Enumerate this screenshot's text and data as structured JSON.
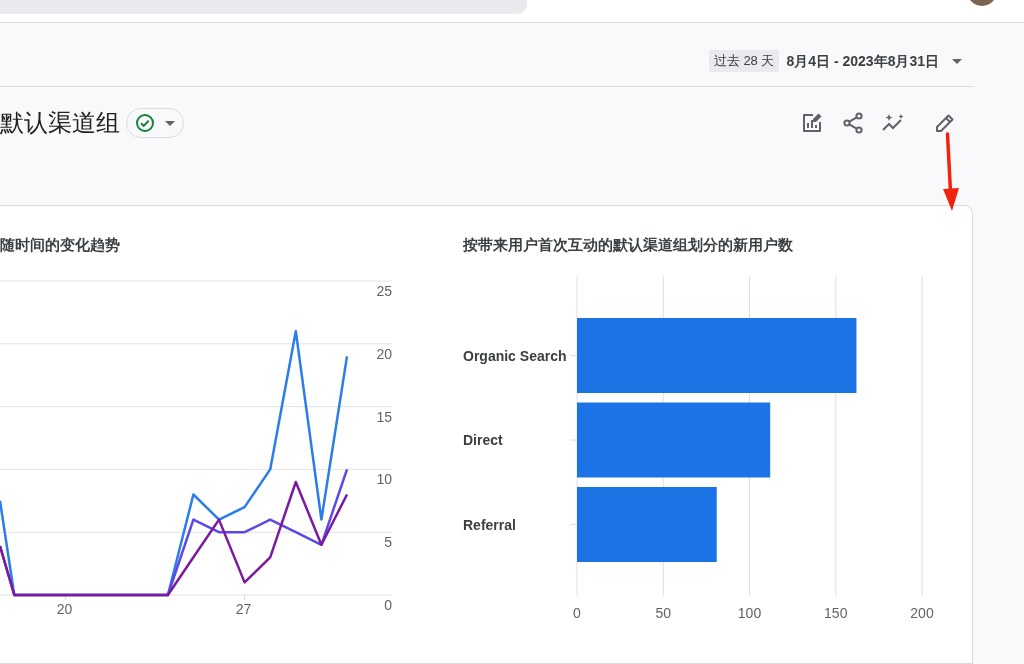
{
  "header": {
    "date_preset": "过去 28 天",
    "date_range": "8月4日 - 2023年8月31日"
  },
  "report": {
    "title": "默认渠道组"
  },
  "cards": [
    {
      "title": "随时间的变化趋势",
      "chart_data": {
        "type": "line",
        "x": [
          17.44,
          18,
          19,
          20,
          21,
          22,
          23,
          24,
          25,
          26,
          27,
          28,
          29,
          30,
          31
        ],
        "xlim": [
          17.44,
          32.76
        ],
        "xticks": [
          20,
          27
        ],
        "grid": true,
        "ylim": [
          0,
          25
        ],
        "yticks": [
          0,
          5,
          10,
          15,
          20,
          25
        ],
        "series": [
          {
            "color": "#2b7de9",
            "values": [
              7.5,
              0,
              0,
              0,
              0,
              0,
              0,
              0,
              8,
              6,
              7,
              10,
              21,
              6,
              19
            ]
          },
          {
            "color": "#5a4ae3",
            "values": [
              3.9,
              0,
              0,
              0,
              0,
              0,
              0,
              0,
              6,
              5,
              5,
              6,
              5,
              4,
              10
            ]
          },
          {
            "color": "#7a1aa0",
            "values": [
              3.9,
              0,
              0,
              0,
              0,
              0,
              0,
              0,
              3,
              6,
              1,
              3,
              9,
              4,
              8
            ]
          }
        ]
      }
    },
    {
      "title": "按带来用户首次互动的默认渠道组划分的新用户数",
      "chart_data": {
        "type": "bar",
        "orientation": "horizontal",
        "categories": [
          "Organic Search",
          "Direct",
          "Referral"
        ],
        "xlim": [
          0,
          200
        ],
        "xticks": [
          0,
          50,
          100,
          150,
          200
        ],
        "grid": true,
        "series": [
          {
            "color": "#1c73e6",
            "values": [
              162,
              112,
              81
            ]
          }
        ]
      }
    }
  ]
}
